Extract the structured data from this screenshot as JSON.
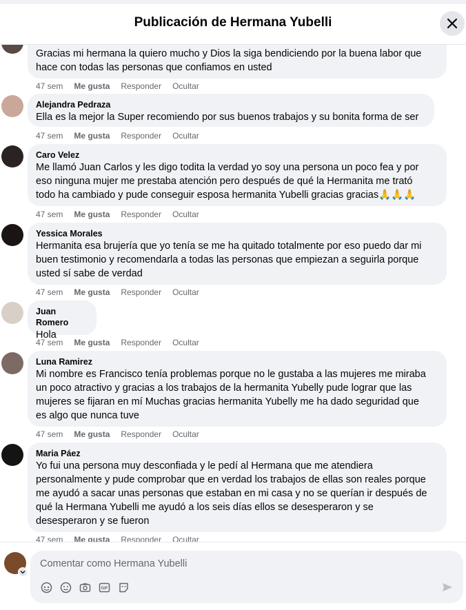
{
  "header": {
    "title": "Publicación de Hermana Yubelli",
    "close_icon": "close-icon"
  },
  "comments": [
    {
      "author": "",
      "text_lines": [
        "Gracias mi hermana la quiero mucho y Dios la siga bendiciendo por la buena labor que",
        "hace con todas las personas que confiamos en usted"
      ],
      "time": "47 sem",
      "like": "Me gusta",
      "reply": "Responder",
      "hide": "Ocultar"
    },
    {
      "author": "Alejandra Pedraza",
      "text_lines": [
        "Ella es la mejor la Super recomiendo por sus buenos trabajos y su bonita forma de ser"
      ],
      "time": "47 sem",
      "like": "Me gusta",
      "reply": "Responder",
      "hide": "Ocultar"
    },
    {
      "author": "Caro Velez",
      "text_lines": [
        "Me llamó Juan Carlos y les digo todita la verdad yo soy una persona un poco fea y por",
        "eso ninguna mujer me prestaba atención pero después de qué la Hermanita me trató",
        "todo ha cambiado y pude conseguir esposa hermanita Yubelli gracias gracias🙏🙏🙏"
      ],
      "time": "47 sem",
      "like": "Me gusta",
      "reply": "Responder",
      "hide": "Ocultar"
    },
    {
      "author": "Yessica Morales",
      "text_lines": [
        "Hermanita esa brujería que yo tenía se me ha quitado totalmente por eso puedo dar mi",
        "buen testimonio y recomendarla a todas las personas que empiezan a seguirla porque",
        "usted sí sabe de verdad"
      ],
      "time": "47 sem",
      "like": "Me gusta",
      "reply": "Responder",
      "hide": "Ocultar"
    },
    {
      "author": "Juan Romero",
      "text_lines": [
        "Hola"
      ],
      "time": "47 sem",
      "like": "Me gusta",
      "reply": "Responder",
      "hide": "Ocultar"
    },
    {
      "author": "Luna Ramirez",
      "text_lines": [
        "Mi nombre es Francisco tenía problemas porque no le gustaba a las mujeres me miraba",
        "un poco atractivo y gracias a los trabajos de la hermanita Yubelly pude lograr que las",
        "mujeres se fijaran en mí Muchas gracias hermanita Yubelly me ha dado seguridad que",
        "es algo que nunca tuve"
      ],
      "time": "47 sem",
      "like": "Me gusta",
      "reply": "Responder",
      "hide": "Ocultar"
    },
    {
      "author": "Maria Páez",
      "text_lines": [
        "Yo fui una persona muy desconfiada y le pedí al Hermana que me atendiera",
        "personalmente y pude comprobar que en verdad los trabajos de ellas son reales porque",
        "me ayudó a sacar unas personas que estaban en mi casa y no se querían ir después de",
        "qué la Hermana Yubelli me ayudó a los seis días ellos se desesperaron y se",
        "desesperaron y se fueron"
      ],
      "time": "47 sem",
      "like": "Me gusta",
      "reply": "Responder",
      "hide": "Ocultar"
    }
  ],
  "composer": {
    "placeholder": "Comentar como Hermana Yubelli",
    "tool_icons": [
      "avatar-sticker-icon",
      "emoji-icon",
      "camera-icon",
      "gif-icon",
      "sticker-icon"
    ],
    "send_icon": "send-icon"
  },
  "colors": {
    "bubble": "#f0f2f5",
    "meta": "#65676b",
    "text": "#050505"
  }
}
